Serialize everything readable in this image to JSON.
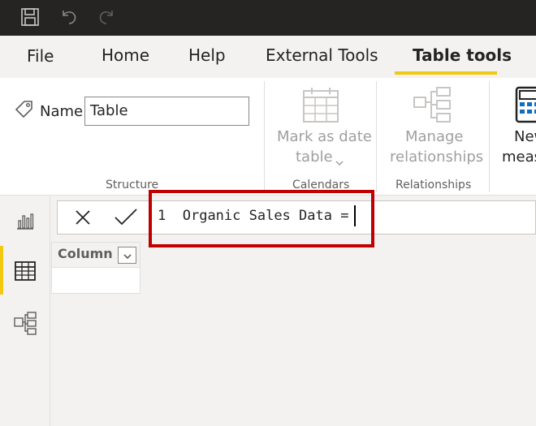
{
  "titlebar": {
    "icons": [
      "save-icon",
      "undo-icon",
      "redo-icon"
    ]
  },
  "tabs": {
    "file": "File",
    "home": "Home",
    "help": "Help",
    "external_tools": "External Tools",
    "table_tools": "Table tools",
    "active": "Table tools",
    "accent_color": "#f2c811"
  },
  "ribbon": {
    "name_label": "Name",
    "name_value": "Table",
    "structure_label": "Structure",
    "mark_as_date_line1": "Mark as date",
    "mark_as_date_line2": "table",
    "calendars_label": "Calendars",
    "manage_line1": "Manage",
    "manage_line2": "relationships",
    "relationships_label": "Relationships",
    "new_measure_line1": "New",
    "new_measure_line2": "measure"
  },
  "formula_bar": {
    "line_number": "1",
    "text": "Organic Sales Data = ",
    "highlight_color": "#c00000"
  },
  "table": {
    "column_header": "Column"
  },
  "left_rail": {
    "icons": [
      "report-view-icon",
      "data-view-icon",
      "model-view-icon"
    ],
    "active": "data-view-icon"
  }
}
